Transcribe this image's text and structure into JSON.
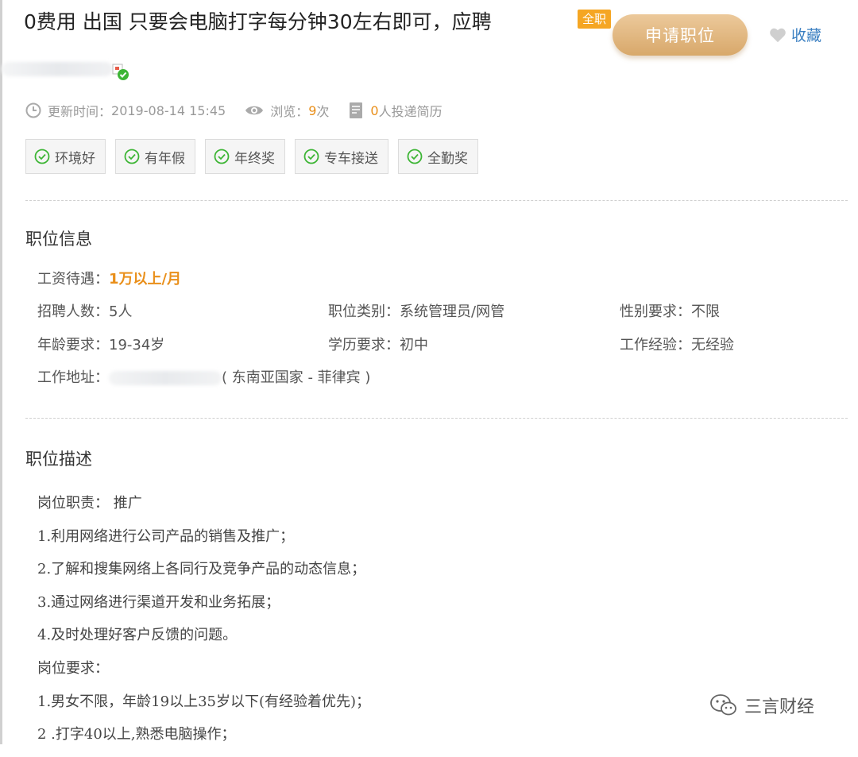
{
  "job": {
    "title": "0费用 出国 只要会电脑打字每分钟30左右即可，应聘",
    "badge": "全职",
    "apply_label": "申请职位",
    "favorite_label": "收藏"
  },
  "meta": {
    "update_label": "更新时间：",
    "update_time": "2019-08-14 15:45",
    "views_label": "浏览：",
    "views_count": "9",
    "views_unit": "次",
    "resume_count": "0",
    "resume_label": "人投递简历"
  },
  "tags": [
    "环境好",
    "有年假",
    "年终奖",
    "专车接送",
    "全勤奖"
  ],
  "position_info": {
    "section_title": "职位信息",
    "salary_label": "工资待遇：",
    "salary_value": "1万以上/月",
    "headcount_label": "招聘人数：",
    "headcount_value": "5人",
    "category_label": "职位类别：",
    "category_value": "系统管理员/网管",
    "gender_label": "性别要求：",
    "gender_value": "不限",
    "age_label": "年龄要求：",
    "age_value": "19-34岁",
    "education_label": "学历要求：",
    "education_value": "初中",
    "experience_label": "工作经验：",
    "experience_value": "无经验",
    "address_label": "工作地址：",
    "address_region": "( 东南亚国家 - 菲律宾 )"
  },
  "description": {
    "section_title": "职位描述",
    "lines": [
      "岗位职责： 推广",
      "1.利用网络进行公司产品的销售及推广；",
      "2.了解和搜集网络上各同行及竞争产品的动态信息；",
      "3.通过网络进行渠道开发和业务拓展；",
      "4.及时处理好客户反馈的问题。",
      "岗位要求：",
      "1.男女不限，年龄19以上35岁以下(有经验着优先)；",
      "2 .打字40以上,熟悉电脑操作；"
    ]
  },
  "watermark": {
    "text": "三言财经"
  },
  "colors": {
    "accent_orange": "#e98f1a",
    "badge_bg": "#f5a623",
    "link_blue": "#3a7fc1",
    "check_green": "#3db535"
  },
  "icons": {
    "update": "clock-icon",
    "views": "eye-icon",
    "resume": "document-icon",
    "favorite": "heart-icon",
    "tag": "check-circle-icon",
    "verified": "verified-badge-icon",
    "watermark": "wechat-icon"
  }
}
